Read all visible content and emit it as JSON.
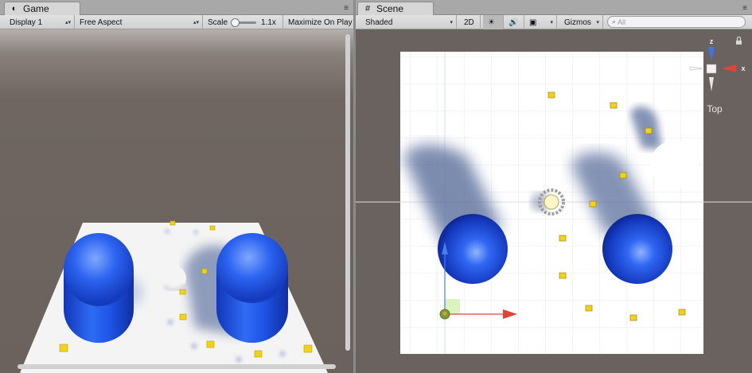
{
  "game": {
    "tab_title": "Game",
    "display": "Display 1",
    "aspect": "Free Aspect",
    "scale_label": "Scale",
    "scale_value": "1.1x",
    "maximize": "Maximize On Play"
  },
  "scene": {
    "tab_title": "Scene",
    "shading": "Shaded",
    "mode_2d": "2D",
    "gizmos": "Gizmos",
    "search_placeholder": "All",
    "orientation": "Top",
    "axis_z": "z",
    "axis_x": "x"
  },
  "icons": {
    "game": "game-controller-icon",
    "scene": "scene-grid-icon",
    "lighting": "sun-icon",
    "audio": "speaker-icon",
    "effects": "image-icon",
    "search": "search-icon",
    "lock": "lock-icon"
  },
  "colors": {
    "capsule_blue": "#1f55e6",
    "scene_bg": "#6a625e",
    "toolbar": "#d6d6d6",
    "coin_yellow": "#f2d21b"
  }
}
